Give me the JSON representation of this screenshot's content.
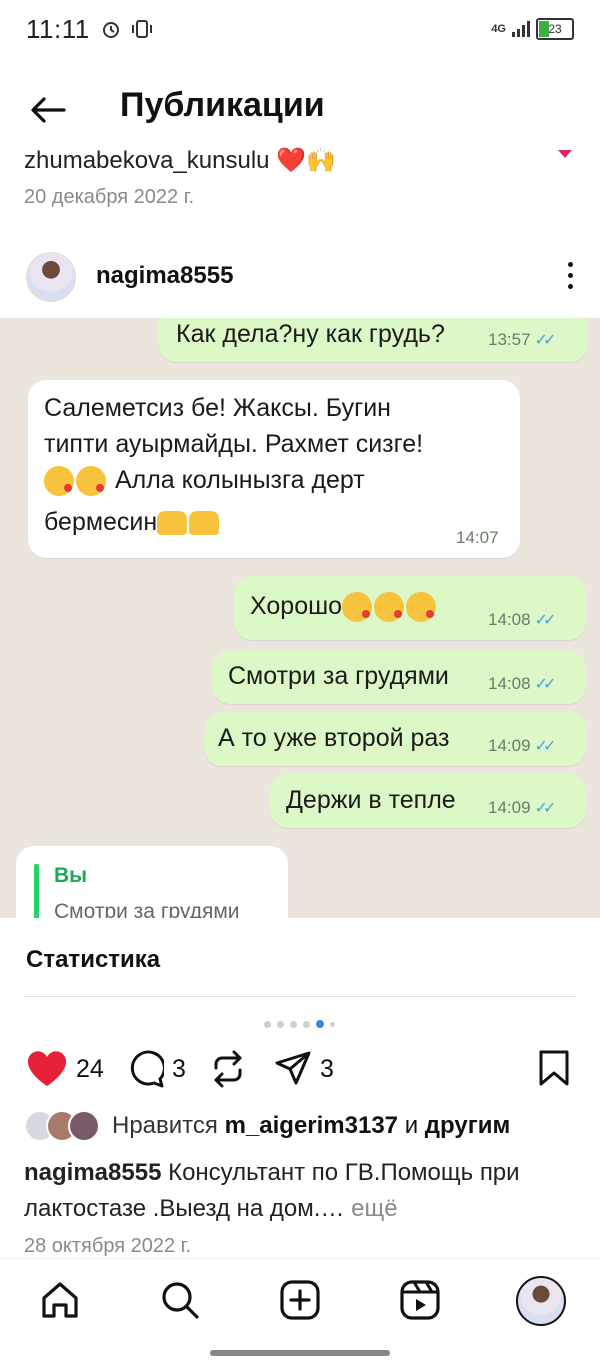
{
  "status_bar": {
    "time": "11:11",
    "network": "4G",
    "battery": "23"
  },
  "header": {
    "title": "Публикации"
  },
  "previous_post": {
    "username": "zhumabekova_kunsulu ❤️🙌",
    "date": "20 декабря 2022 г."
  },
  "post": {
    "username": "nagima8555",
    "chat": {
      "messages": [
        {
          "from": "me",
          "text": "Как дела?ну как грудь?",
          "time": "13:57"
        },
        {
          "from": "them",
          "lines": [
            "Салеметсиз бе! Жаксы. Бугин",
            "типти ауырмайды. Рахмет сизге!",
            "Алла колынызга дерт",
            "бермесин"
          ],
          "time": "14:07"
        },
        {
          "from": "me",
          "text": "Хорошо",
          "time": "14:08"
        },
        {
          "from": "me",
          "text": "Смотри за грудями",
          "time": "14:08"
        },
        {
          "from": "me",
          "text": "А то уже второй раз",
          "time": "14:09"
        },
        {
          "from": "me",
          "text": "Держи в тепле",
          "time": "14:09"
        }
      ],
      "quote": {
        "author": "Вы",
        "text": "Смотри за грудями"
      }
    },
    "statistics_label": "Статистика",
    "carousel": {
      "count": 6,
      "active": 5
    },
    "likes_count": "24",
    "comments_count": "3",
    "shares_count": "3",
    "liked_by": {
      "prefix": "Нравится",
      "user": "m_aigerim3137",
      "joiner": "и",
      "suffix": "другим"
    },
    "caption": {
      "user": "nagima8555",
      "text": "Консультант по ГВ.Помощь при лактостазе .Выезд на дом.…",
      "more": "ещё"
    },
    "date": "28 октября 2022 г."
  },
  "colors": {
    "like": "#e8213b",
    "bubble_out": "#dcf8c6",
    "chat_bg": "#ece5dd",
    "active_dot": "#3b82f6"
  },
  "icons": [
    "back-arrow-icon",
    "heart-icon",
    "comment-icon",
    "repost-icon",
    "send-icon",
    "bookmark-icon",
    "home-icon",
    "search-icon",
    "create-icon",
    "reels-icon",
    "profile-icon"
  ]
}
